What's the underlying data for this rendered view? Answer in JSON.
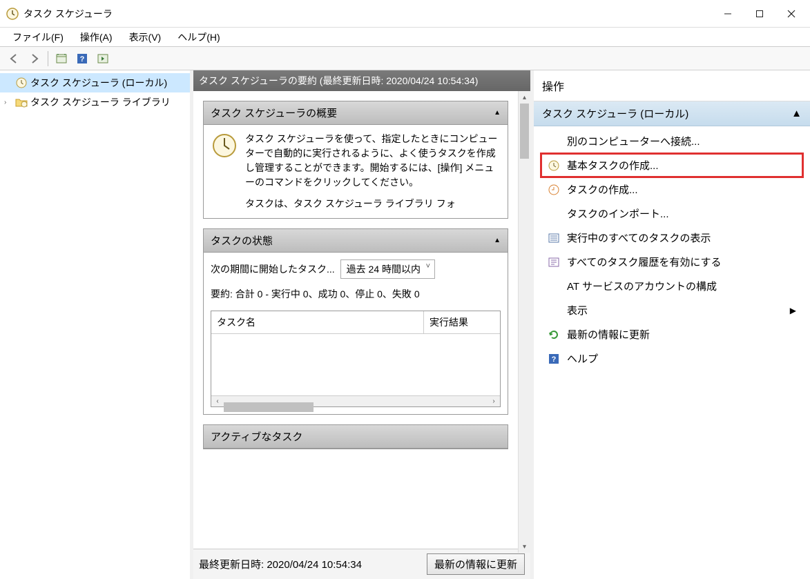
{
  "window": {
    "title": "タスク スケジューラ"
  },
  "menubar": {
    "file": "ファイル(F)",
    "action": "操作(A)",
    "view": "表示(V)",
    "help": "ヘルプ(H)"
  },
  "tree": {
    "root": "タスク スケジューラ (ローカル)",
    "library": "タスク スケジューラ ライブラリ"
  },
  "center": {
    "header": "タスク スケジューラの要約 (最終更新日時: 2020/04/24 10:54:34)",
    "overview_title": "タスク スケジューラの概要",
    "overview_body": "タスク スケジューラを使って、指定したときにコンピューターで自動的に実行されるように、よく使うタスクを作成し管理することができます。開始するには、[操作] メニューのコマンドをクリックしてください。",
    "overview_body2": "タスクは、タスク スケジューラ ライブラリ フォ",
    "status_title": "タスクの状態",
    "status_period_label": "次の期間に開始したタスク...",
    "status_period_value": "過去 24 時間以内",
    "status_summary": "要約: 合計 0 - 実行中 0、成功 0、停止 0、失敗 0",
    "table_col_name": "タスク名",
    "table_col_result": "実行結果",
    "active_title": "アクティブなタスク",
    "footer_last_update": "最終更新日時: 2020/04/24 10:54:34",
    "footer_refresh": "最新の情報に更新"
  },
  "actions": {
    "pane_title": "操作",
    "group_title": "タスク スケジューラ (ローカル)",
    "items": {
      "connect": "別のコンピューターへ接続...",
      "create_basic": "基本タスクの作成...",
      "create_task": "タスクの作成...",
      "import_task": "タスクのインポート...",
      "running_tasks": "実行中のすべてのタスクの表示",
      "enable_history": "すべてのタスク履歴を有効にする",
      "at_account": "AT サービスのアカウントの構成",
      "view": "表示",
      "refresh": "最新の情報に更新",
      "help": "ヘルプ"
    }
  }
}
